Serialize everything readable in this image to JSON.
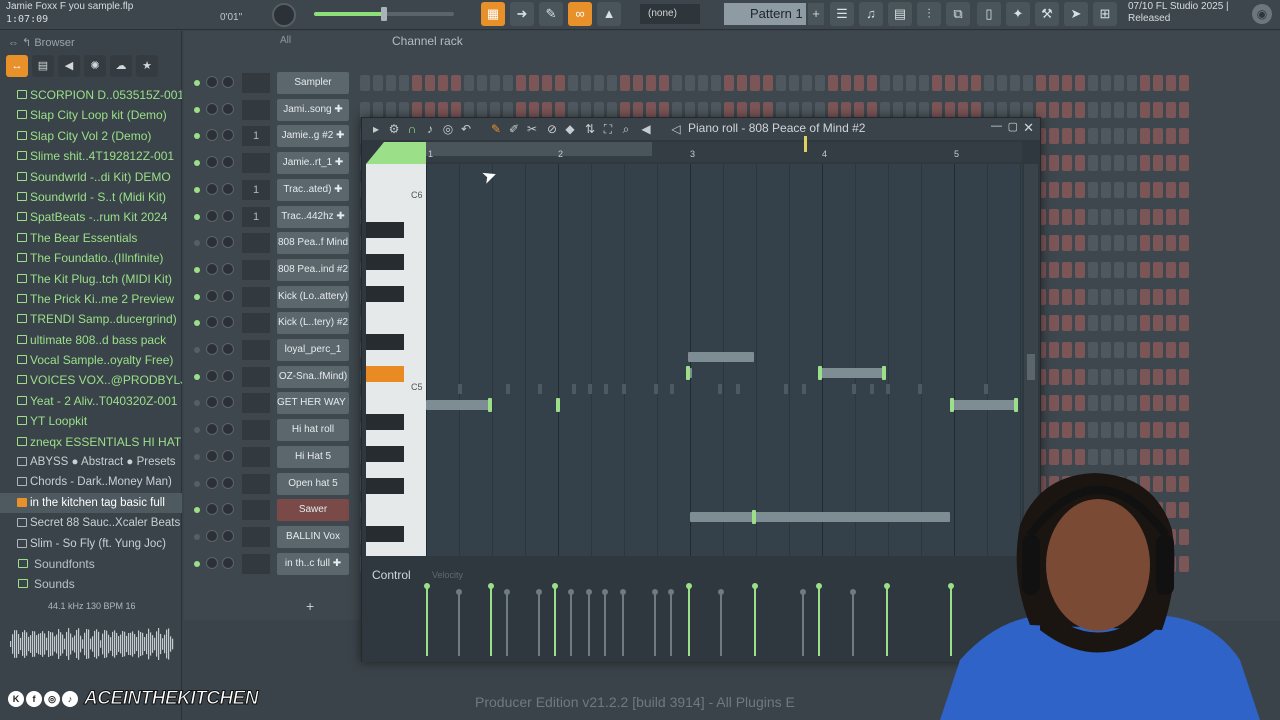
{
  "topbar": {
    "project_title": "Jamie Foxx F you sample.flp",
    "time": "1:07:09",
    "hint_time": "0'01\"",
    "none_label": "(none)",
    "pattern_label": "Pattern 1",
    "plus": "+",
    "status_date": "07/10  FL Studio 2025 |",
    "status_release": "Released"
  },
  "browser": {
    "header": "Browser",
    "items": [
      {
        "label": "SCORPION D..053515Z-001",
        "kind": "folder"
      },
      {
        "label": "Slap City Loop kit (Demo)",
        "kind": "folder"
      },
      {
        "label": "Slap City Vol 2 (Demo)",
        "kind": "folder"
      },
      {
        "label": "Slime shit..4T192812Z-001",
        "kind": "folder"
      },
      {
        "label": "Soundwrld -..di Kit) DEMO",
        "kind": "folder"
      },
      {
        "label": "Soundwrld - S..t (Midi Kit)",
        "kind": "folder"
      },
      {
        "label": "SpatBeats -..rum Kit 2024",
        "kind": "folder"
      },
      {
        "label": "The Bear Essentials",
        "kind": "folder"
      },
      {
        "label": "The Foundatio..(IIlnfinite)",
        "kind": "folder"
      },
      {
        "label": "The Kit Plug..tch (MIDI Kit)",
        "kind": "folder"
      },
      {
        "label": "The Prick Ki..me 2 Preview",
        "kind": "folder"
      },
      {
        "label": "TRENDI Samp..ducergrind)",
        "kind": "folder"
      },
      {
        "label": "ultimate 808..d bass pack",
        "kind": "folder"
      },
      {
        "label": "Vocal Sample..oyalty Free)",
        "kind": "folder"
      },
      {
        "label": "VOICES VOX..@PRODBYLJS",
        "kind": "folder"
      },
      {
        "label": "Yeat - 2 Aliv..T040320Z-001",
        "kind": "folder"
      },
      {
        "label": "YT Loopkit",
        "kind": "folder"
      },
      {
        "label": "zneqx ESSENTIALS HI HAT",
        "kind": "folder"
      },
      {
        "label": "ABYSS ● Abstract ● Presets",
        "kind": "file"
      },
      {
        "label": "Chords - Dark..Money Man)",
        "kind": "file"
      },
      {
        "label": "in the kitchen tag basic full",
        "kind": "selected"
      },
      {
        "label": "Secret 88 Sauc..Xcaler Beats",
        "kind": "file"
      },
      {
        "label": "Slim - So Fly (ft. Yung Joc)",
        "kind": "file"
      },
      {
        "label": "Soundfonts",
        "kind": "top"
      },
      {
        "label": "Sounds",
        "kind": "top"
      }
    ],
    "sample_info": "44.1 kHz 130 BPM 16"
  },
  "rack": {
    "all_label": "All",
    "title": "Channel rack",
    "channels": [
      {
        "num": "",
        "name": "Sampler",
        "led": true,
        "red": false
      },
      {
        "num": "",
        "name": "Jami..song ✚",
        "led": true,
        "red": false
      },
      {
        "num": "1",
        "name": "Jamie..g #2 ✚",
        "led": true,
        "red": false
      },
      {
        "num": "",
        "name": "Jamie..rt_1 ✚",
        "led": true,
        "red": false
      },
      {
        "num": "1",
        "name": "Trac..ated) ✚",
        "led": true,
        "red": false
      },
      {
        "num": "1",
        "name": "Trac..442hz ✚",
        "led": true,
        "red": false
      },
      {
        "num": "",
        "name": "808 Pea..f Mind",
        "led": false,
        "red": false
      },
      {
        "num": "",
        "name": "808 Pea..ind #2",
        "led": true,
        "red": false
      },
      {
        "num": "",
        "name": "Kick (Lo..attery)",
        "led": true,
        "red": false
      },
      {
        "num": "",
        "name": "Kick (L..tery) #2",
        "led": true,
        "red": false
      },
      {
        "num": "",
        "name": "loyal_perc_1",
        "led": false,
        "red": false
      },
      {
        "num": "",
        "name": "OZ-Sna..fMind)",
        "led": true,
        "red": false
      },
      {
        "num": "",
        "name": "GET HER WAY hh",
        "led": false,
        "red": false
      },
      {
        "num": "",
        "name": "Hi hat roll",
        "led": false,
        "red": false
      },
      {
        "num": "",
        "name": "Hi Hat 5",
        "led": false,
        "red": false
      },
      {
        "num": "",
        "name": "Open hat 5",
        "led": false,
        "red": false
      },
      {
        "num": "",
        "name": "Sawer",
        "led": true,
        "red": true
      },
      {
        "num": "",
        "name": "BALLIN Vox",
        "led": false,
        "red": false
      },
      {
        "num": "",
        "name": "in th..c full ✚",
        "led": true,
        "red": false
      }
    ],
    "add_label": "+"
  },
  "piano_roll": {
    "title": "Piano roll - 808 Peace of Mind #2",
    "bar_numbers": [
      "1",
      "2",
      "3",
      "4",
      "5"
    ],
    "key_labels": {
      "c6": "C6",
      "c5": "C5"
    },
    "control_label": "Control",
    "control_sub": "Velocity",
    "close": "✕",
    "minimize": "—",
    "maximize": "▢"
  },
  "footer": {
    "producer_text": "Producer Edition v21.2.2 [build 3914] - All Plugins E",
    "channel_handle": "ACEINTHEKITCHEN"
  },
  "colors": {
    "accent": "#e8902a",
    "green": "#9be089",
    "background": "#3a4349"
  }
}
